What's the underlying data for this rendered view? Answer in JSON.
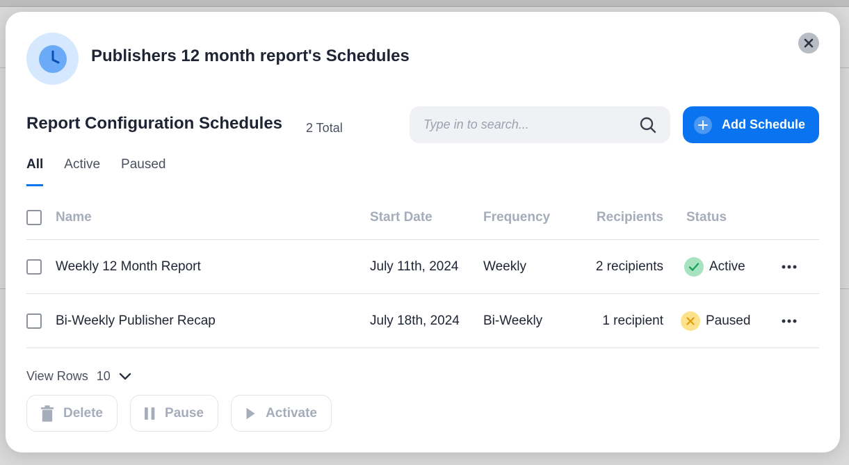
{
  "modal": {
    "title": "Publishers 12 month report's Schedules"
  },
  "section": {
    "title": "Report Configuration Schedules",
    "total": "2 Total"
  },
  "search": {
    "placeholder": "Type in to search..."
  },
  "add_button": {
    "label": "Add Schedule"
  },
  "tabs": [
    {
      "label": "All",
      "active": true
    },
    {
      "label": "Active",
      "active": false
    },
    {
      "label": "Paused",
      "active": false
    }
  ],
  "table": {
    "columns": {
      "name": "Name",
      "start_date": "Start Date",
      "frequency": "Frequency",
      "recipients": "Recipients",
      "status": "Status"
    },
    "rows": [
      {
        "name": "Weekly 12 Month Report",
        "start_date": "July 11th, 2024",
        "frequency": "Weekly",
        "recipients": "2 recipients",
        "status": "Active"
      },
      {
        "name": "Bi-Weekly Publisher Recap",
        "start_date": "July 18th, 2024",
        "frequency": "Bi-Weekly",
        "recipients": "1 recipient",
        "status": "Paused"
      }
    ]
  },
  "pagination": {
    "label": "View Rows",
    "value": "10"
  },
  "actions": {
    "delete": "Delete",
    "pause": "Pause",
    "activate": "Activate"
  },
  "colors": {
    "accent": "#0a74f0",
    "active_status": "#a7e3c1",
    "paused_status": "#fde28c"
  },
  "icons": [
    "clock-icon",
    "close-icon",
    "search-icon",
    "plus-icon",
    "check-icon",
    "x-icon",
    "more-icon",
    "chevron-down-icon",
    "trash-icon",
    "pause-icon",
    "play-icon"
  ]
}
